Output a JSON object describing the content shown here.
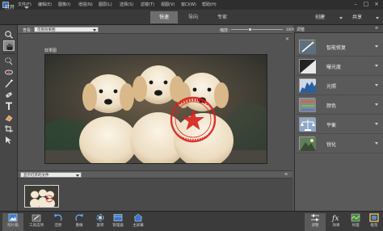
{
  "menubar": {
    "items": [
      "文件(F)",
      "编辑(E)",
      "图像(I)",
      "增强(N)",
      "图层(L)",
      "选择(S)",
      "滤镜(T)",
      "视图(V)",
      "窗口(W)",
      "帮助(H)"
    ]
  },
  "modebar": {
    "open_label": "打开",
    "tabs": [
      "快速",
      "导向",
      "专家"
    ],
    "create_label": "创建",
    "share_label": "共享"
  },
  "options": {
    "view_label": "查看：",
    "view_value": "仅限效果图",
    "zoom_label": "缩放：",
    "zoom_value": "100%",
    "zoom_fraction": 0.36
  },
  "canvas": {
    "after_label": "效果图",
    "close_glyph": "×"
  },
  "bin": {
    "select_value": "显示打开的文件",
    "menu_glyph": "≡"
  },
  "panel": {
    "title": "调整",
    "menu_glyph": "≡",
    "items": [
      {
        "label": "智能修复",
        "icon": "smart-fix-icon"
      },
      {
        "label": "曝光度",
        "icon": "exposure-icon"
      },
      {
        "label": "光照",
        "icon": "lighting-icon"
      },
      {
        "label": "颜色",
        "icon": "color-icon"
      },
      {
        "label": "平衡",
        "icon": "balance-icon"
      },
      {
        "label": "锐化",
        "icon": "sharpen-icon"
      }
    ]
  },
  "taskbar": {
    "items": [
      {
        "label": "照片箱",
        "icon": "photo-bin-icon"
      },
      {
        "label": "工具选项",
        "icon": "tool-options-icon"
      },
      {
        "label": "还原",
        "icon": "undo-icon"
      },
      {
        "label": "重做",
        "icon": "redo-icon"
      },
      {
        "label": "旋转",
        "icon": "rotate-icon"
      },
      {
        "label": "管理器",
        "icon": "organizer-icon"
      },
      {
        "label": "主屏幕",
        "icon": "home-screen-icon"
      },
      {
        "label": "调整",
        "icon": "adjustments-icon"
      },
      {
        "label": "效果",
        "icon": "effects-icon"
      },
      {
        "label": "纹理",
        "icon": "textures-icon"
      },
      {
        "label": "框架",
        "icon": "frames-icon"
      }
    ]
  },
  "colors": {
    "accent_stamp": "#d6201d",
    "active_tab": "#6e6e6e",
    "panel_bg": "#5a5a5a"
  }
}
